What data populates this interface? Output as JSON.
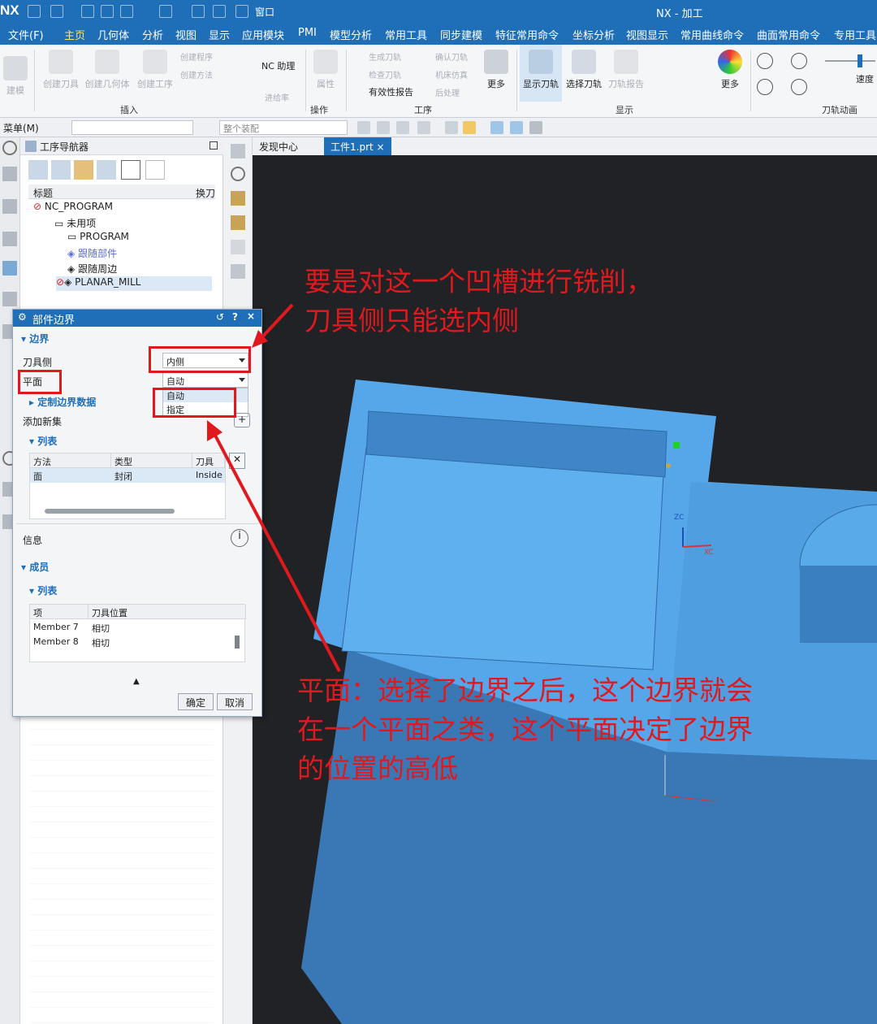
{
  "titlebar": {
    "logo": "NX",
    "window_menu": "窗口",
    "app_title": "NX - 加工"
  },
  "menubar": {
    "tabs": [
      "文件(F)",
      "主页",
      "几何体",
      "分析",
      "视图",
      "显示",
      "应用模块",
      "PMI",
      "模型分析",
      "常用工具",
      "同步建模",
      "特征常用命令",
      "坐标分析",
      "视图显示",
      "常用曲线命令",
      "曲面常用命令",
      "专用工具"
    ]
  },
  "ribbon": {
    "buttons": {
      "bjie": "建模",
      "create_tool": "创建刀具",
      "create_geom": "创建几何体",
      "create_op": "创建工序",
      "create_prog": "创建程序",
      "create_method": "创建方法",
      "nc_assist": "NC 助理",
      "feed_rate": "进给率",
      "attribute": "属性",
      "gen_path": "生成刀轨",
      "check_path": "检查刀轨",
      "validity": "有效性报告",
      "confirm_path": "确认刀轨",
      "machine_sim": "机床仿真",
      "post": "后处理",
      "more": "更多",
      "show_path": "显示刀轨",
      "select_path": "选择刀轨",
      "path_report": "刀轨报告",
      "more2": "更多",
      "speed": "速度"
    },
    "groups": {
      "insert": "插入",
      "operation": "操作",
      "process": "工序",
      "display": "显示",
      "animation": "刀轨动画"
    }
  },
  "toolbar2": {
    "menu": "菜单(M)",
    "assembly": "整个装配"
  },
  "navigator": {
    "title": "工序导航器",
    "col_title": "标题",
    "col_change": "换刀",
    "rows": [
      {
        "label": "NC_PROGRAM"
      },
      {
        "label": "未用项"
      },
      {
        "label": "PROGRAM"
      },
      {
        "label": "跟随部件"
      },
      {
        "label": "跟随周边"
      },
      {
        "label": "PLANAR_MILL"
      }
    ]
  },
  "gtabs": {
    "discover": "发现中心",
    "part": "工件1.prt"
  },
  "dialog": {
    "title": "部件边界",
    "sec_boundary": "边界",
    "tool_side_label": "刀具侧",
    "tool_side_value": "内侧",
    "plane_label": "平面",
    "plane_value": "自动",
    "plane_options": [
      "自动",
      "指定"
    ],
    "custom": "定制边界数据",
    "add_set": "添加新集",
    "sec_list": "列表",
    "list_headers": [
      "方法",
      "类型",
      "刀具侧"
    ],
    "list_rows": [
      [
        "面",
        "封闭",
        "Inside"
      ]
    ],
    "info": "信息",
    "sec_members": "成员",
    "sec_list2": "列表",
    "member_headers": [
      "项",
      "刀具位置"
    ],
    "member_rows": [
      [
        "Member 7",
        "相切"
      ],
      [
        "Member 8",
        "相切"
      ]
    ],
    "ok": "确定",
    "cancel": "取消"
  },
  "annotations": {
    "anno1_line1": "要是对这一个凹槽进行铣削，",
    "anno1_line2": "刀具侧只能选内侧",
    "anno2_line1": "平面：选择了边界之后，这个边界就会",
    "anno2_line2": "在一个平面之类，这个平面决定了边界",
    "anno2_line3": "的位置的高低"
  },
  "axes": {
    "zc": "ZC",
    "xc": "XC"
  },
  "colors": {
    "accent": "#1e6fb8",
    "annotation": "#e0191f",
    "model": "#5aaeea"
  }
}
